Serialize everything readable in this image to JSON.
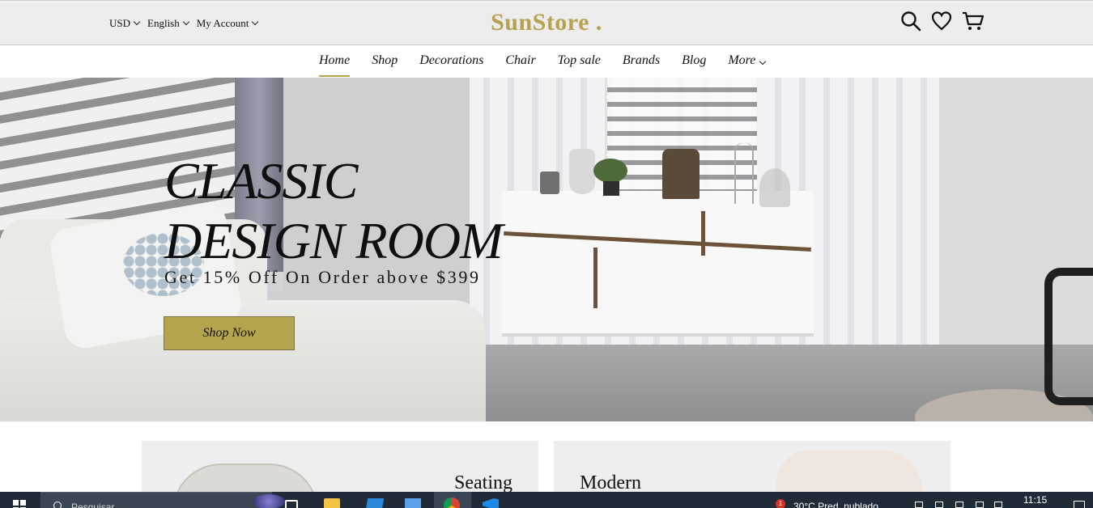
{
  "header": {
    "currency": "USD",
    "language": "English",
    "account": "My Account",
    "logo": "SunStore .",
    "icons": [
      "search-icon",
      "heart-icon",
      "cart-icon"
    ]
  },
  "nav": {
    "items": [
      {
        "label": "Home",
        "active": true
      },
      {
        "label": "Shop"
      },
      {
        "label": "Decorations"
      },
      {
        "label": "Chair"
      },
      {
        "label": "Top sale"
      },
      {
        "label": "Brands"
      },
      {
        "label": "Blog"
      },
      {
        "label": "More"
      }
    ]
  },
  "hero": {
    "title_line1": "CLASSIC",
    "title_line2": "DESIGN ROOM",
    "subtitle": "Get 15% Off On Order above $399",
    "button": "Shop Now"
  },
  "cards": {
    "left_title": "Seating",
    "right_title": "Modern"
  },
  "taskbar": {
    "search_placeholder": "Pesquisar",
    "notification_count": "1",
    "weather": "30°C  Pred. nublado",
    "time": "11:15"
  },
  "colors": {
    "accent": "#b8a24f",
    "button": "#b4a44e",
    "header_bg": "#ededed",
    "taskbar_bg": "#1f2b37"
  }
}
